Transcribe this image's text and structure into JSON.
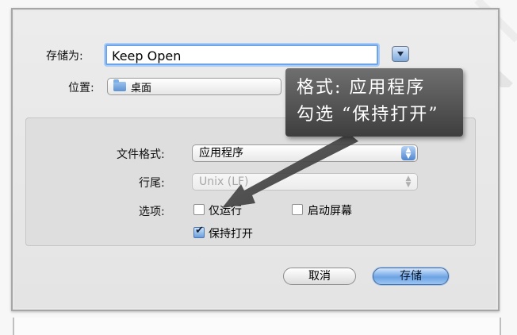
{
  "dialog": {
    "save_as_label": "存储为:",
    "save_as_value": "Keep Open",
    "location_label": "位置:",
    "location_value": "桌面",
    "format_label": "文件格式:",
    "format_value": "应用程序",
    "line_ending_label": "行尾:",
    "line_ending_value": "Unix (LF)",
    "options_label": "选项:",
    "options": [
      {
        "label": "仅运行",
        "checked": false
      },
      {
        "label": "启动屏幕",
        "checked": false
      },
      {
        "label": "保持打开",
        "checked": true
      }
    ],
    "cancel_label": "取消",
    "save_label": "存储"
  },
  "annotation": {
    "line1": "格式: 应用程序",
    "line2": "勾选 “保持打开”"
  },
  "colors": {
    "accent": "#6fa4e8",
    "callout_bg": "#4a4a4a"
  }
}
